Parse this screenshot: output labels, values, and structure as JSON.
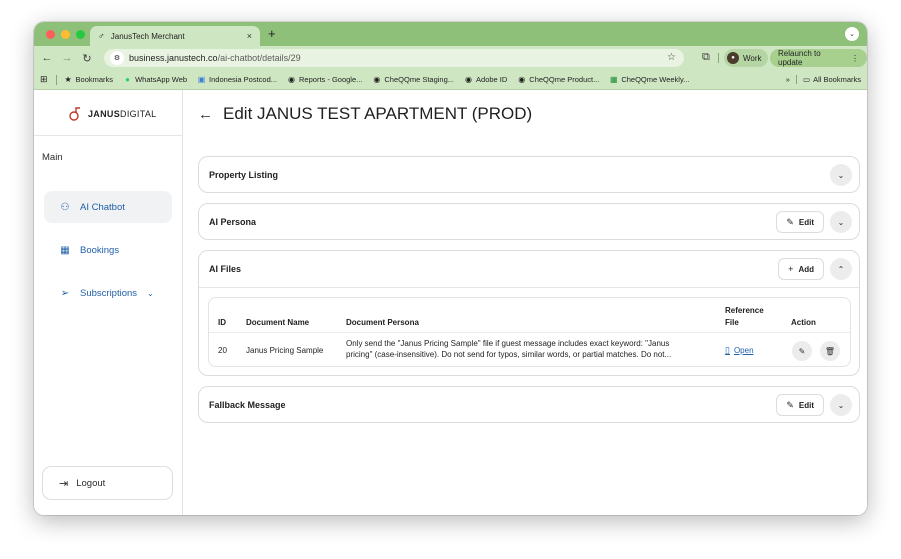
{
  "browser": {
    "tab_title": "JanusTech Merchant",
    "tab_close": "×",
    "new_tab": "+",
    "tab_menu": "⌄",
    "url_host": "business.janustech.co",
    "url_path": "/ai-chatbot/details/29",
    "profile_label": "Work",
    "relaunch_label": "Relaunch to update",
    "bookmarks": [
      {
        "label": "Bookmarks",
        "icon": "star-icon",
        "glyph": "★",
        "color": "#1f1f1f"
      },
      {
        "label": "WhatsApp Web",
        "icon": "whatsapp-icon",
        "glyph": "●",
        "color": "#25d366"
      },
      {
        "label": "Indonesia Postcod...",
        "icon": "doc-icon",
        "glyph": "▣",
        "color": "#3b7dd8"
      },
      {
        "label": "Reports - Google...",
        "icon": "globe-icon",
        "glyph": "◉",
        "color": "#1f1f1f"
      },
      {
        "label": "CheQQme Staging...",
        "icon": "globe-icon",
        "glyph": "◉",
        "color": "#1f1f1f"
      },
      {
        "label": "Adobe ID",
        "icon": "globe-icon",
        "glyph": "◉",
        "color": "#1f1f1f"
      },
      {
        "label": "CheQQme Product...",
        "icon": "globe-icon",
        "glyph": "◉",
        "color": "#1f1f1f"
      },
      {
        "label": "CheQQme Weekly...",
        "icon": "sheet-icon",
        "glyph": "▦",
        "color": "#1e8e3e"
      }
    ],
    "more_bookmarks": "»",
    "all_bookmarks": "All Bookmarks"
  },
  "sidebar": {
    "logo_bold": "JANUS",
    "logo_rest": "DIGITAL",
    "section": "Main",
    "items": [
      {
        "label": "AI Chatbot",
        "icon": "robot-icon",
        "glyph": "⚇"
      },
      {
        "label": "Bookings",
        "icon": "calendar-icon",
        "glyph": "▦"
      },
      {
        "label": "Subscriptions",
        "icon": "send-icon",
        "glyph": "➢"
      }
    ],
    "logout": "Logout"
  },
  "page": {
    "back": "←",
    "title": "Edit JANUS TEST APARTMENT (PROD)",
    "cards": {
      "property": "Property Listing",
      "persona": "AI Persona",
      "files": "AI Files",
      "fallback": "Fallback Message"
    },
    "edit_label": "Edit",
    "add_label": "Add",
    "table": {
      "headers": [
        "ID",
        "Document Name",
        "Document Persona",
        "Reference",
        "File",
        "Action"
      ],
      "rows": [
        {
          "id": "20",
          "name": "Janus Pricing Sample",
          "persona_line1": "Only send the \"Janus Pricing Sample\" file if guest message includes exact keyword: \"Janus",
          "persona_line2": "pricing\" (case-insensitive). Do not send for typos, similar words, or partial matches. Do not...",
          "file_link": "Open"
        }
      ]
    }
  },
  "colors": {
    "chrome_green": "#8fc07a",
    "toolbar_green": "#cfe6c2",
    "accent_blue": "#1f5fa8"
  }
}
